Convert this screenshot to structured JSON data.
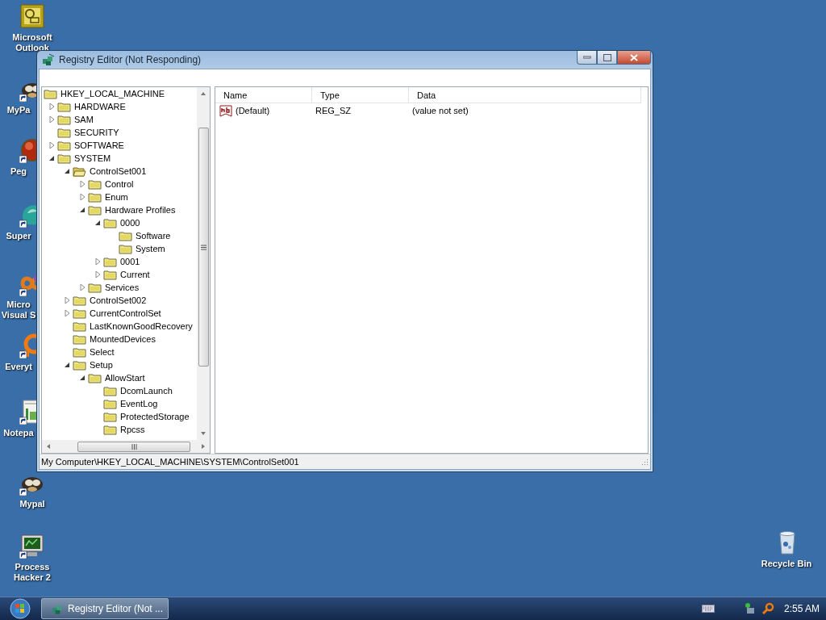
{
  "desktop_icons": [
    {
      "label": "Microsoft Outlook",
      "kind": "mail",
      "shortcut": false
    },
    {
      "label": "MyPa",
      "kind": "animal",
      "shortcut": true
    },
    {
      "label": "Peg",
      "kind": "ball",
      "shortcut": true
    },
    {
      "label": "Super",
      "kind": "blob",
      "shortcut": true
    },
    {
      "label": "Micro Visual S",
      "kind": "infinity",
      "shortcut": true
    },
    {
      "label": "Everyt",
      "kind": "ring",
      "shortcut": true
    },
    {
      "label": "Notepa",
      "kind": "notepad",
      "shortcut": true
    },
    {
      "label": "Mypal",
      "kind": "animal",
      "shortcut": true
    },
    {
      "label": "Process Hacker 2",
      "kind": "monitor",
      "shortcut": true
    },
    {
      "label": "Recycle Bin",
      "kind": "bin",
      "shortcut": false
    }
  ],
  "window": {
    "title": "Registry Editor (Not Responding)",
    "tree": {
      "label": "HKEY_LOCAL_MACHINE",
      "selected": false,
      "children": [
        {
          "label": "HARDWARE",
          "expanded": false,
          "selected": false
        },
        {
          "label": "SAM",
          "expanded": false,
          "selected": false
        },
        {
          "label": "SECURITY",
          "selected": false
        },
        {
          "label": "SOFTWARE",
          "expanded": false,
          "selected": false
        },
        {
          "label": "SYSTEM",
          "expanded": true,
          "selected": false,
          "children": [
            {
              "label": "ControlSet001",
              "expanded": true,
              "selected": true,
              "children": [
                {
                  "label": "Control",
                  "expanded": false,
                  "selected": false
                },
                {
                  "label": "Enum",
                  "expanded": false,
                  "selected": false
                },
                {
                  "label": "Hardware Profiles",
                  "expanded": true,
                  "selected": false,
                  "children": [
                    {
                      "label": "0000",
                      "expanded": true,
                      "selected": false,
                      "children": [
                        {
                          "label": "Software",
                          "selected": false
                        },
                        {
                          "label": "System",
                          "selected": false
                        }
                      ]
                    },
                    {
                      "label": "0001",
                      "expanded": false,
                      "selected": false
                    },
                    {
                      "label": "Current",
                      "expanded": false,
                      "selected": false
                    }
                  ]
                },
                {
                  "label": "Services",
                  "expanded": false,
                  "selected": false
                }
              ]
            },
            {
              "label": "ControlSet002",
              "expanded": false,
              "selected": false
            },
            {
              "label": "CurrentControlSet",
              "expanded": false,
              "selected": false
            },
            {
              "label": "LastKnownGoodRecovery",
              "selected": false
            },
            {
              "label": "MountedDevices",
              "selected": false
            },
            {
              "label": "Select",
              "selected": false
            },
            {
              "label": "Setup",
              "expanded": true,
              "selected": false,
              "children": [
                {
                  "label": "AllowStart",
                  "expanded": true,
                  "selected": false,
                  "children": [
                    {
                      "label": "DcomLaunch",
                      "selected": false
                    },
                    {
                      "label": "EventLog",
                      "selected": false
                    },
                    {
                      "label": "ProtectedStorage",
                      "selected": false
                    },
                    {
                      "label": "Rpcss",
                      "selected": false
                    }
                  ]
                }
              ]
            }
          ]
        }
      ]
    },
    "values_table": {
      "columns": [
        "Name",
        "Type",
        "Data"
      ],
      "rows": [
        {
          "name": "(Default)",
          "type": "REG_SZ",
          "data": "(value not set)"
        }
      ]
    },
    "status_bar": "My Computer\\HKEY_LOCAL_MACHINE\\SYSTEM\\ControlSet001"
  },
  "taskbar": {
    "buttons": [
      {
        "label": "Registry Editor (Not ..."
      }
    ],
    "clock": "2:55 AM"
  }
}
